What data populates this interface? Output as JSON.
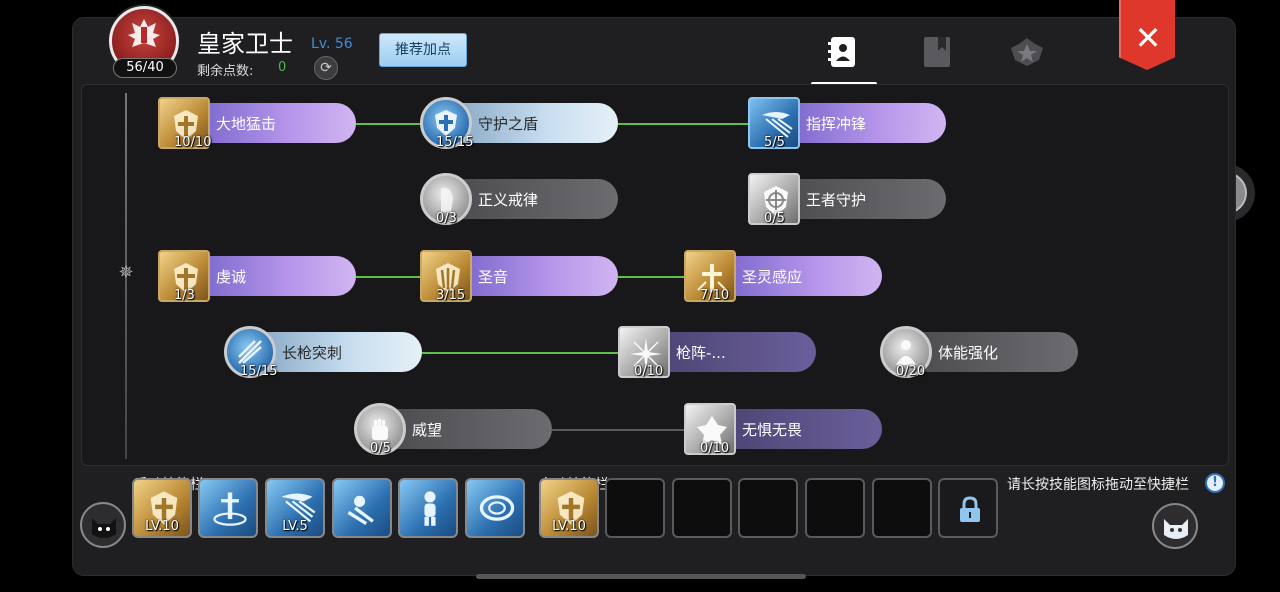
{
  "header": {
    "class_name": "皇家卫士",
    "level": "Lv. 56",
    "emblem_count": "56/40",
    "points_label": "剩余点数:",
    "points_value": "0",
    "recommend_button": "推荐加点",
    "tabs": [
      {
        "icon": "skill-book-icon",
        "active": true
      },
      {
        "icon": "book-icon",
        "active": false
      },
      {
        "icon": "rank-emblem-icon",
        "active": false
      }
    ],
    "close_label": "✕"
  },
  "skills": [
    {
      "name": "大地猛击",
      "level": "10/10",
      "style": "purple",
      "icon": "gold-square"
    },
    {
      "name": "守护之盾",
      "level": "15/15",
      "style": "blue",
      "icon": "blue-round"
    },
    {
      "name": "指挥冲锋",
      "level": "5/5",
      "style": "purple",
      "icon": "blue-square"
    },
    {
      "name": "正义戒律",
      "level": "0/3",
      "style": "grey",
      "icon": "silver-round"
    },
    {
      "name": "王者守护",
      "level": "0/5",
      "style": "grey",
      "icon": "silver-square"
    },
    {
      "name": "虔诚",
      "level": "1/3",
      "style": "purple",
      "icon": "gold-square"
    },
    {
      "name": "圣音",
      "level": "3/15",
      "style": "purple",
      "icon": "gold-square"
    },
    {
      "name": "圣灵感应",
      "level": "7/10",
      "style": "purple",
      "icon": "gold-square"
    },
    {
      "name": "长枪突刺",
      "level": "15/15",
      "style": "blue",
      "icon": "blue-round"
    },
    {
      "name": "枪阵-...",
      "level": "0/10",
      "style": "dpurple",
      "icon": "silver-square"
    },
    {
      "name": "体能强化",
      "level": "0/20",
      "style": "grey",
      "icon": "silver-round"
    },
    {
      "name": "威望",
      "level": "0/5",
      "style": "grey",
      "icon": "silver-round"
    },
    {
      "name": "无惧无畏",
      "level": "0/10",
      "style": "dpurple",
      "icon": "silver-square"
    }
  ],
  "manual_bar": {
    "title": "手动技能栏",
    "slots": [
      {
        "level": "LV.10",
        "color": "gold"
      },
      {
        "level": "",
        "color": "blue"
      },
      {
        "level": "LV.5",
        "color": "blue"
      },
      {
        "level": "",
        "color": "blue"
      },
      {
        "level": "",
        "color": "blue"
      },
      {
        "level": "",
        "color": "blue"
      }
    ]
  },
  "auto_bar": {
    "title": "自动技能栏",
    "slots": [
      {
        "level": "LV.10",
        "color": "gold"
      },
      {
        "level": "",
        "color": "empty"
      },
      {
        "level": "",
        "color": "empty"
      },
      {
        "level": "",
        "color": "empty"
      },
      {
        "level": "",
        "color": "empty"
      },
      {
        "level": "",
        "color": "empty"
      },
      {
        "level": "",
        "color": "locked"
      }
    ]
  },
  "hint": {
    "text": "请长按技能图标拖动至快捷栏",
    "info_icon": "!"
  },
  "colors": {
    "accent_green": "#5fbf4a",
    "level_blue": "#3f8fd8",
    "close_red": "#e0372c"
  }
}
